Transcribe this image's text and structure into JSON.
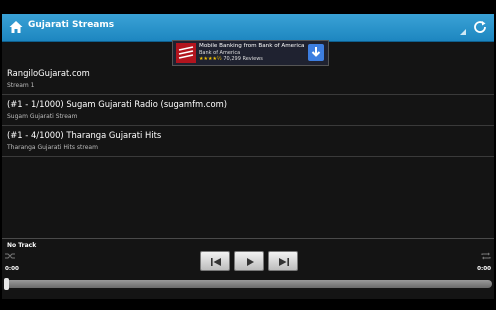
{
  "action_bar": {
    "title": "Gujarati Streams",
    "accent": "#33a0d8"
  },
  "ad": {
    "title": "Mobile Banking from Bank of America",
    "publisher": "Bank of America",
    "stars": "★★★★½",
    "reviews": "70,299 Reviews"
  },
  "streams": [
    {
      "title": "RangiloGujarat.com",
      "subtitle": "Stream 1"
    },
    {
      "title": "(#1 - 1/1000) Sugam Gujarati Radio (sugamfm.com)",
      "subtitle": "Sugam Gujarati Stream"
    },
    {
      "title": "(#1 - 4/1000) Tharanga Gujarati Hits",
      "subtitle": "Tharanga Gujarati Hits stream"
    }
  ],
  "player": {
    "now_playing": "No Track",
    "time_elapsed": "0:00",
    "time_total": "0:00",
    "progress": 0
  },
  "icons": {
    "home": "home-icon",
    "refresh": "refresh-icon",
    "shuffle": "shuffle-icon",
    "repeat": "repeat-icon",
    "previous": "skip-previous-icon",
    "play": "play-icon",
    "next": "skip-next-icon"
  }
}
